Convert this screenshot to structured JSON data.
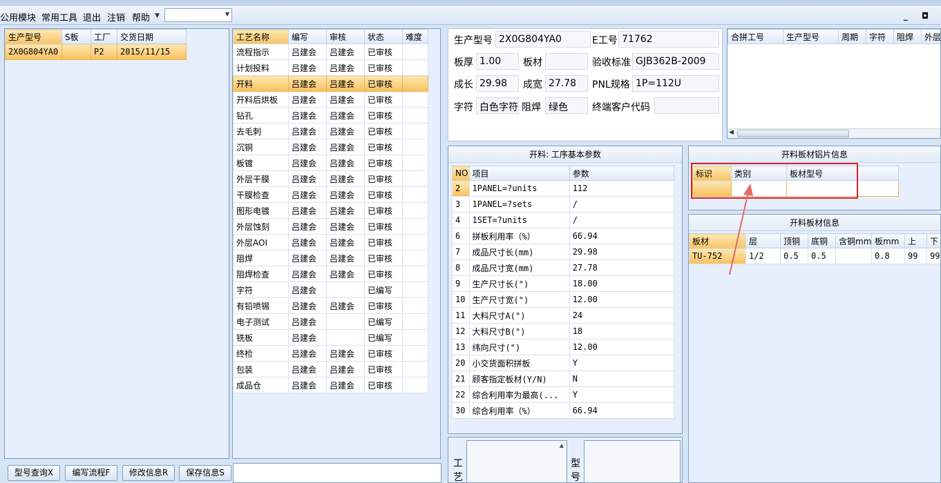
{
  "menu": {
    "items": [
      "公用模块",
      "常用工具",
      "退出",
      "注销",
      "帮助"
    ],
    "window_buttons": "_ ◘"
  },
  "orders": {
    "columns": [
      "生产型号",
      "S板",
      "工厂",
      "交货日期"
    ],
    "rows": [
      [
        "2X0G804YA0",
        "",
        "P2",
        "2015/11/15"
      ]
    ]
  },
  "process": {
    "columns": [
      "工艺名称",
      "编写",
      "审核",
      "状态",
      "难度"
    ],
    "rows": [
      [
        "流程指示",
        "吕建会",
        "吕建会",
        "已审核",
        ""
      ],
      [
        "计划投料",
        "吕建会",
        "吕建会",
        "已审核",
        ""
      ],
      [
        "开料",
        "吕建会",
        "吕建会",
        "已审核",
        ""
      ],
      [
        "开料后烘板",
        "吕建会",
        "吕建会",
        "已审核",
        ""
      ],
      [
        "钻孔",
        "吕建会",
        "吕建会",
        "已审核",
        ""
      ],
      [
        "去毛刺",
        "吕建会",
        "吕建会",
        "已审核",
        ""
      ],
      [
        "沉铜",
        "吕建会",
        "吕建会",
        "已审核",
        ""
      ],
      [
        "板镀",
        "吕建会",
        "吕建会",
        "已审核",
        ""
      ],
      [
        "外层干膜",
        "吕建会",
        "吕建会",
        "已审核",
        ""
      ],
      [
        "干膜检查",
        "吕建会",
        "吕建会",
        "已审核",
        ""
      ],
      [
        "图形电镀",
        "吕建会",
        "吕建会",
        "已审核",
        ""
      ],
      [
        "外层蚀刻",
        "吕建会",
        "吕建会",
        "已审核",
        ""
      ],
      [
        "外层AOI",
        "吕建会",
        "吕建会",
        "已审核",
        ""
      ],
      [
        "阻焊",
        "吕建会",
        "吕建会",
        "已审核",
        ""
      ],
      [
        "阻焊检查",
        "吕建会",
        "吕建会",
        "已审核",
        ""
      ],
      [
        "字符",
        "吕建会",
        "",
        "已编写",
        ""
      ],
      [
        "有铅喷锡",
        "吕建会",
        "吕建会",
        "已审核",
        ""
      ],
      [
        "电子测试",
        "吕建会",
        "",
        "已编写",
        ""
      ],
      [
        "铣板",
        "吕建会",
        "",
        "已编写",
        ""
      ],
      [
        "终检",
        "吕建会",
        "吕建会",
        "已审核",
        ""
      ],
      [
        "包装",
        "吕建会",
        "吕建会",
        "已审核",
        ""
      ],
      [
        "成品仓",
        "吕建会",
        "吕建会",
        "已审核",
        ""
      ]
    ]
  },
  "info": {
    "model_label": "生产型号",
    "model_value": "2X0G804YA0",
    "eno_label": "E工号",
    "eno_value": "71762",
    "thick_label": "板厚",
    "thick_value": "1.00",
    "material_label": "板材",
    "material_value": "",
    "standard_label": "验收标准",
    "standard_value": "GJB362B-2009",
    "len_label": "成长",
    "len_value": "29.98",
    "width_label": "成宽",
    "width_value": "27.78",
    "pnl_label": "PNL规格",
    "pnl_value": "1P=112U",
    "char_label": "字符",
    "char_value": "白色字符",
    "mask_label": "阻焊",
    "mask_value": "绿色",
    "customer_label": "终端客户代码",
    "customer_value": ""
  },
  "combined": {
    "columns": [
      "合拼工号",
      "生产型号",
      "周期",
      "字符",
      "阻焊",
      "外层"
    ]
  },
  "params": {
    "title": "开料: 工序基本参数",
    "columns": [
      "NO",
      "项目",
      "参数"
    ],
    "rows": [
      [
        "2",
        "1PANEL=?units",
        "112"
      ],
      [
        "3",
        "1PANEL=?sets",
        "/"
      ],
      [
        "4",
        "1SET=?units",
        "/"
      ],
      [
        "6",
        "拼板利用率（%）",
        "66.94"
      ],
      [
        "7",
        "成品尺寸长(mm)",
        "29.98"
      ],
      [
        "8",
        "成品尺寸宽(mm)",
        "27.78"
      ],
      [
        "9",
        "生产尺寸长(\")",
        "18.00"
      ],
      [
        "10",
        "生产尺寸宽(\")",
        "12.00"
      ],
      [
        "11",
        "大料尺寸A(\")",
        "24"
      ],
      [
        "12",
        "大料尺寸B(\")",
        "18"
      ],
      [
        "13",
        "纬向尺寸(\")",
        "12.00"
      ],
      [
        "20",
        "小交货面积拼板",
        "Y"
      ],
      [
        "21",
        "顾客指定板材(Y/N)",
        "N"
      ],
      [
        "22",
        "综合利用率为最高(...",
        "Y"
      ],
      [
        "30",
        "综合利用率（%）",
        "66.94"
      ]
    ]
  },
  "alu": {
    "title": "开料板材铝片信息",
    "columns": [
      "标识",
      "类别",
      "板材型号"
    ]
  },
  "board": {
    "title": "开料板材信息",
    "columns": [
      "板材",
      "层",
      "顶铜",
      "底铜",
      "含铜mm",
      "板mm",
      "上",
      "下"
    ],
    "rows": [
      [
        "TU-752",
        "1/2",
        "0.5",
        "0.5",
        "",
        "0.8",
        "99",
        "99"
      ]
    ]
  },
  "bottom": {
    "craft_label": "工艺",
    "model_label": "型号"
  },
  "buttons": {
    "query": "型号查询X",
    "write": "编写流程F",
    "modify": "修改信息R",
    "save": "保存信息S"
  },
  "colors": {
    "selection": "#f8c05c",
    "annotation": "#d9202a"
  }
}
